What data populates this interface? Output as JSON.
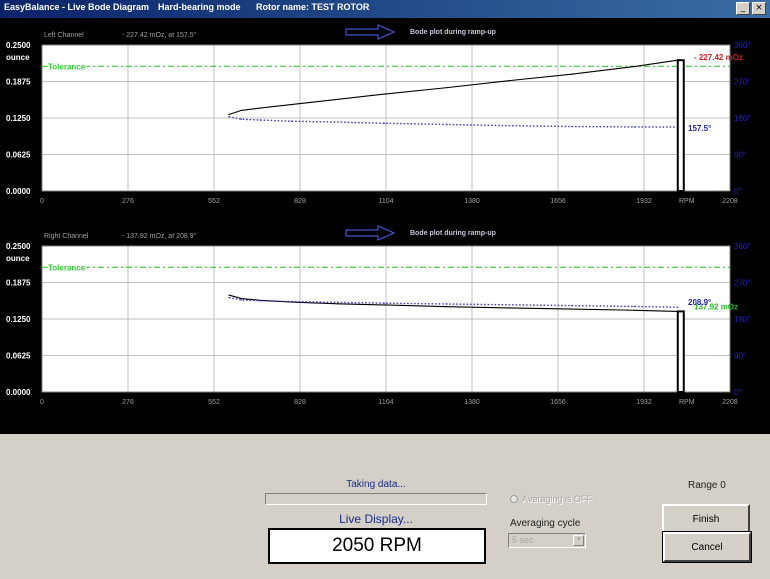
{
  "window": {
    "app_title": "EasyBalance - Live Bode Diagram",
    "mode": "Hard-bearing mode",
    "rotor_name": "Rotor name: TEST ROTOR",
    "minimize_glyph": "_",
    "close_glyph": "×"
  },
  "charts_common": {
    "y_left_ticks": [
      "0.2500",
      "0.1875",
      "0.1250",
      "0.0625",
      "0.0000"
    ],
    "y_unit": "ounce",
    "y_right_ticks": [
      "360°",
      "270°",
      "180°",
      "90°",
      "0°"
    ],
    "x_ticks": [
      "0",
      "276",
      "552",
      "828",
      "1104",
      "1380",
      "1656",
      "1932",
      "2208"
    ],
    "x_unit_label": "RPM",
    "tolerance_label": "Tolerance",
    "banner": "Bode plot during ramp-up",
    "colors": {
      "background": "#ffffff",
      "grid": "#c0c0c0",
      "tolerance": "#33cc33",
      "amplitude": "#000000",
      "phase": "#3333cc",
      "amp_readout_left": "#cc2020",
      "amp_readout_right": "#22bb22",
      "phase_readout": "#2222aa",
      "axis_text": "#a0a0a0",
      "right_axis_text": "#2222cc"
    }
  },
  "chart_data": [
    {
      "type": "line",
      "title": "Left Channel",
      "readout": "227.42 mOz, at 157.5°",
      "x_range": [
        0,
        2208
      ],
      "y_left_range": [
        0,
        0.25
      ],
      "y_right_range": [
        0,
        360
      ],
      "tolerance": 0.2135,
      "current_rpm": 2050,
      "series": [
        {
          "axis": "left",
          "x": [
            600,
            640,
            700,
            800,
            950,
            1100,
            1300,
            1500,
            1700,
            1900,
            2040
          ],
          "y": [
            0.131,
            0.138,
            0.142,
            0.148,
            0.157,
            0.166,
            0.177,
            0.189,
            0.2,
            0.213,
            0.224
          ]
        },
        {
          "axis": "right",
          "style": "dotted",
          "x": [
            600,
            640,
            700,
            800,
            950,
            1100,
            1300,
            1500,
            1700,
            1900,
            2040
          ],
          "y": [
            183,
            177,
            175,
            172,
            170,
            167,
            164,
            161,
            159,
            158,
            157.5
          ]
        }
      ],
      "value_labels": {
        "amplitude": "227.42 mOz",
        "phase": "157.5°"
      }
    },
    {
      "type": "line",
      "title": "Right Channel",
      "readout": "137.92 mOz, at 208.9°",
      "x_range": [
        0,
        2208
      ],
      "y_left_range": [
        0,
        0.25
      ],
      "y_right_range": [
        0,
        360
      ],
      "tolerance": 0.2135,
      "current_rpm": 2050,
      "series": [
        {
          "axis": "left",
          "x": [
            600,
            640,
            700,
            800,
            950,
            1100,
            1300,
            1500,
            1700,
            1900,
            2040
          ],
          "y": [
            0.166,
            0.16,
            0.157,
            0.154,
            0.151,
            0.149,
            0.146,
            0.144,
            0.142,
            0.14,
            0.138
          ]
        },
        {
          "axis": "right",
          "style": "dotted",
          "x": [
            600,
            640,
            700,
            800,
            950,
            1100,
            1300,
            1500,
            1700,
            1900,
            2040
          ],
          "y": [
            233,
            227,
            225,
            223,
            221,
            219,
            217,
            215,
            213,
            211,
            209
          ]
        }
      ],
      "value_labels": {
        "amplitude": "137.92 mOz",
        "phase": "208.9°"
      }
    }
  ],
  "controls": {
    "status": "Taking data...",
    "progress": 0,
    "live_display": "Live Display...",
    "rpm": "2050 RPM",
    "averaging_status": "Averaging is OFF",
    "averaging_cycle_label": "Averaging cycle",
    "averaging_cycle_value": "5 sec",
    "range": "Range 0",
    "finish": "Finish",
    "cancel": "Cancel"
  }
}
